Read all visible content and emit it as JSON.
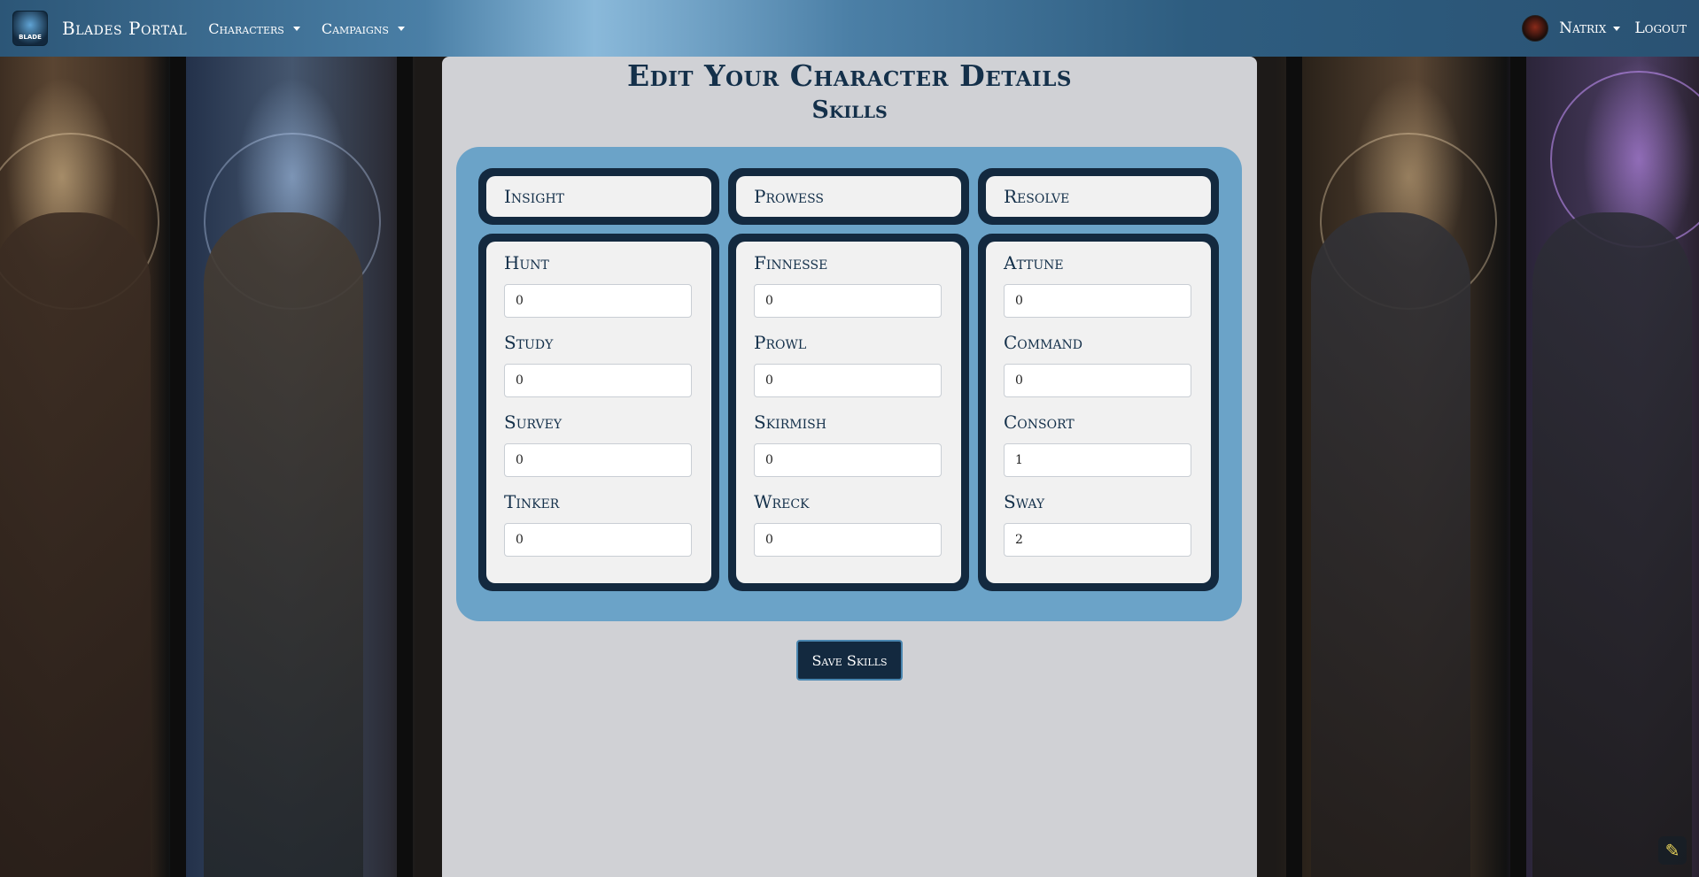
{
  "navbar": {
    "brand_logo_text": "BLADE",
    "brand_title": "Blades Portal",
    "menu": [
      {
        "label": "Characters"
      },
      {
        "label": "Campaigns"
      }
    ],
    "user_name": "Natrix",
    "logout_label": "Logout"
  },
  "page": {
    "title": "Edit Your Character Details",
    "section": "Skills"
  },
  "attributes": [
    {
      "name": "Insight",
      "skills": [
        {
          "label": "Hunt",
          "value": "0"
        },
        {
          "label": "Study",
          "value": "0"
        },
        {
          "label": "Survey",
          "value": "0"
        },
        {
          "label": "Tinker",
          "value": "0"
        }
      ]
    },
    {
      "name": "Prowess",
      "skills": [
        {
          "label": "Finnesse",
          "value": "0"
        },
        {
          "label": "Prowl",
          "value": "0"
        },
        {
          "label": "Skirmish",
          "value": "0"
        },
        {
          "label": "Wreck",
          "value": "0"
        }
      ]
    },
    {
      "name": "Resolve",
      "skills": [
        {
          "label": "Attune",
          "value": "0"
        },
        {
          "label": "Command",
          "value": "0"
        },
        {
          "label": "Consort",
          "value": "1"
        },
        {
          "label": "Sway",
          "value": "2"
        }
      ]
    }
  ],
  "save_button_label": "Save Skills",
  "colors": {
    "navbar_accent": "#4a7fa6",
    "panel_dark": "#13293f",
    "skills_box": "#6ba3c8",
    "heading_text": "#14304a"
  },
  "icons": {
    "caret": "chevron-down-icon",
    "edit": "pen-icon"
  }
}
